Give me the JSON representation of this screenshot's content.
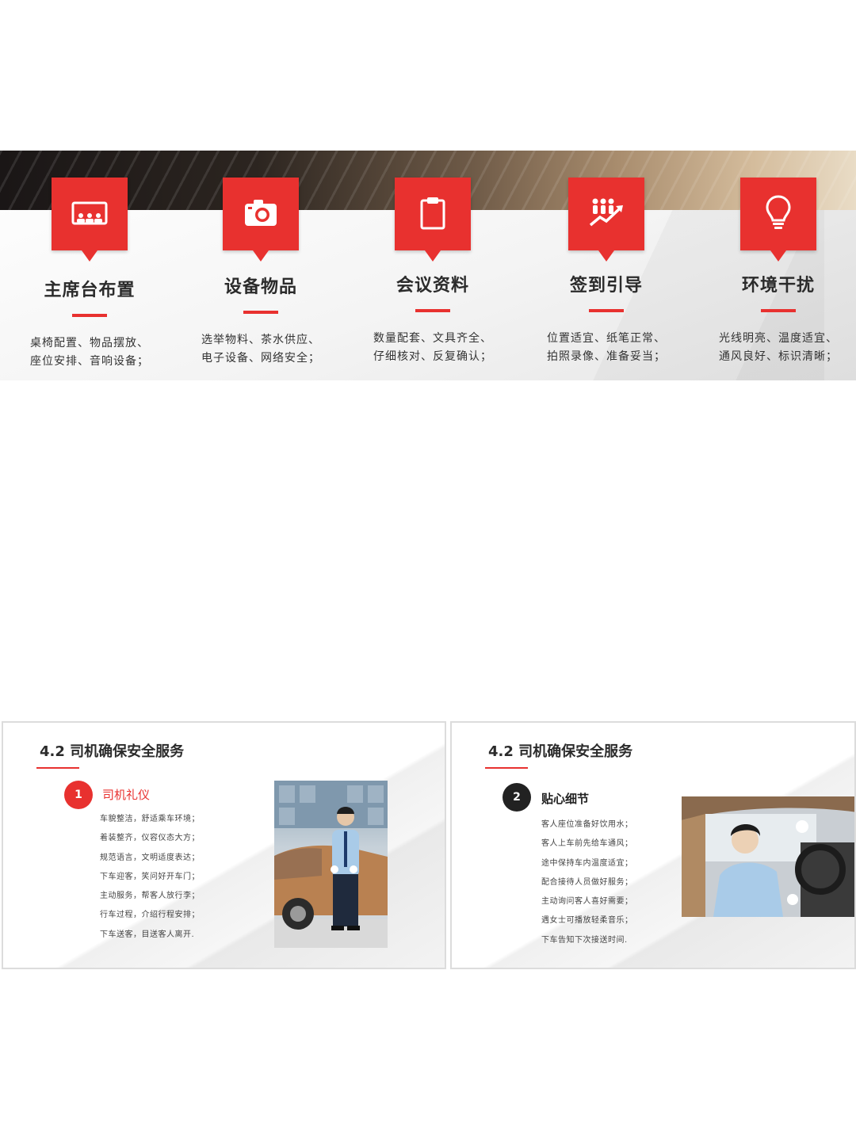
{
  "top_slide": {
    "pillars": [
      {
        "icon": "meeting-room-icon",
        "title": "主席台布置",
        "desc_line1": "桌椅配置、物品摆放、",
        "desc_line2": "座位安排、音响设备；"
      },
      {
        "icon": "camera-icon",
        "title": "设备物品",
        "desc_line1": "选举物料、茶水供应、",
        "desc_line2": "电子设备、网络安全；"
      },
      {
        "icon": "clipboard-icon",
        "title": "会议资料",
        "desc_line1": "数量配套、文具齐全、",
        "desc_line2": "仔细核对、反复确认；"
      },
      {
        "icon": "growth-team-icon",
        "title": "签到引导",
        "desc_line1": "位置适宜、纸笔正常、",
        "desc_line2": "拍照录像、准备妥当；"
      },
      {
        "icon": "lightbulb-icon",
        "title": "环境干扰",
        "desc_line1": "光线明亮、温度适宜、",
        "desc_line2": "通风良好、标识清晰；"
      }
    ],
    "accent_color": "#e8312f"
  },
  "slide_left": {
    "title": "4.2 司机确保安全服务",
    "number": "1",
    "subtitle": "司机礼仪",
    "items": [
      "车貌整洁，舒适乘车环境；",
      "着装整齐，仪容仪态大方；",
      "规范语言，文明适度表达；",
      "下车迎客，笑问好开车门；",
      "主动服务，帮客人放行李；",
      "行车过程，介绍行程安排；",
      "下车送客，目送客人离开."
    ],
    "number_color": "#e8312f",
    "subtitle_color": "#e8312f"
  },
  "slide_right": {
    "title": "4.2 司机确保安全服务",
    "number": "2",
    "subtitle": "贴心细节",
    "items": [
      "客人座位准备好饮用水；",
      "客人上车前先给车通风；",
      "途中保持车内温度适宜；",
      "配合接待人员做好服务；",
      "主动询问客人喜好需要；",
      "遇女士可播放轻柔音乐；",
      "下车告知下次接送时间."
    ],
    "number_color": "#222222",
    "subtitle_color": "#222222"
  }
}
